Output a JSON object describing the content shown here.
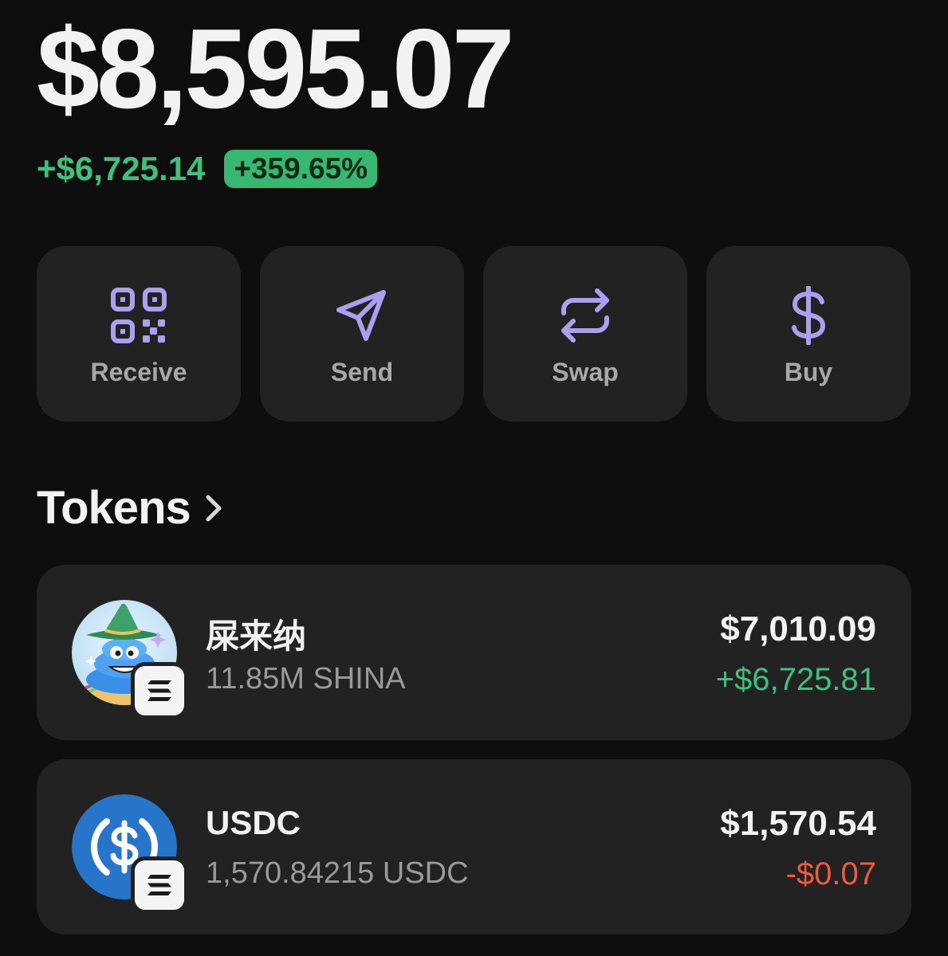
{
  "portfolio": {
    "balance": "$8,595.07",
    "change_amount": "+$6,725.14",
    "change_percent": "+359.65%"
  },
  "colors": {
    "accent": "#ab9ff2",
    "positive": "#3cc27a",
    "negative": "#ee5a3a",
    "card": "#222222",
    "background": "#0e0e0e"
  },
  "actions": [
    {
      "label": "Receive",
      "icon": "qr-code-icon"
    },
    {
      "label": "Send",
      "icon": "send-icon"
    },
    {
      "label": "Swap",
      "icon": "swap-icon"
    },
    {
      "label": "Buy",
      "icon": "dollar-icon"
    }
  ],
  "tokens_section": {
    "title": "Tokens",
    "icon": "chevron-right-icon"
  },
  "tokens": [
    {
      "name": "屎来纳",
      "amount": "11.85M SHINA",
      "value": "$7,010.09",
      "change": "+$6,725.81",
      "logo": "shina-logo",
      "chain_icon": "solana-icon"
    },
    {
      "name": "USDC",
      "amount": "1,570.84215 USDC",
      "value": "$1,570.54",
      "change": "-$0.07",
      "logo": "usdc-logo",
      "chain_icon": "solana-icon"
    }
  ]
}
